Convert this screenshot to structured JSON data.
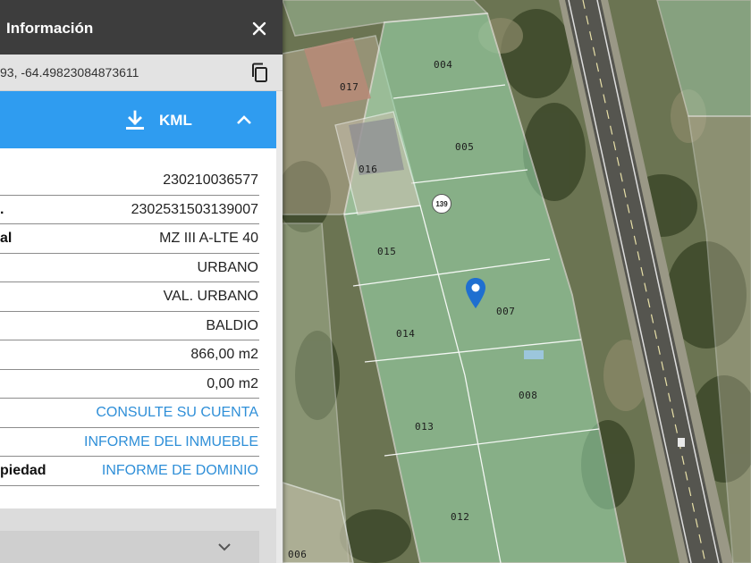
{
  "panel": {
    "title": "Información",
    "coordinates": "93, -64.49823084873611",
    "kml_label": "KML",
    "rows": [
      {
        "label": "",
        "value": "230210036577",
        "link": false
      },
      {
        "label": ".",
        "value": "2302531503139007",
        "link": false
      },
      {
        "label": "al",
        "value": "MZ III A-LTE 40",
        "link": false
      },
      {
        "label": "",
        "value": "URBANO",
        "link": false
      },
      {
        "label": "",
        "value": "VAL. URBANO",
        "link": false
      },
      {
        "label": "",
        "value": "BALDIO",
        "link": false
      },
      {
        "label": "",
        "value": "866,00 m2",
        "link": false
      },
      {
        "label": "",
        "value": "0,00 m2",
        "link": false
      },
      {
        "label": "",
        "value": "CONSULTE SU CUENTA",
        "link": true
      },
      {
        "label": "",
        "value": "INFORME DEL INMUEBLE",
        "link": true
      },
      {
        "label": "piedad",
        "value": "INFORME DE DOMINIO",
        "link": true
      }
    ]
  },
  "map": {
    "route_number": "139",
    "parcels": [
      {
        "id": "p004",
        "label": "004"
      },
      {
        "id": "p017",
        "label": "017"
      },
      {
        "id": "p005",
        "label": "005"
      },
      {
        "id": "p016",
        "label": "016"
      },
      {
        "id": "p015",
        "label": "015"
      },
      {
        "id": "p007",
        "label": "007"
      },
      {
        "id": "p014",
        "label": "014"
      },
      {
        "id": "p008",
        "label": "008"
      },
      {
        "id": "p013",
        "label": "013"
      },
      {
        "id": "p012",
        "label": "012"
      },
      {
        "id": "p006",
        "label": "006"
      }
    ]
  },
  "colors": {
    "header_bg": "#3d3d3d",
    "card_header_bg": "#2f9cf0",
    "link": "#2f8fd8",
    "parcel_fill": "#9fe0b4",
    "pin": "#1f6fd0"
  },
  "icons": {
    "close": "close-icon",
    "copy": "copy-icon",
    "download": "download-icon",
    "collapse": "chevron-up-icon",
    "expand": "chevron-down-icon",
    "pin": "map-pin-icon"
  }
}
